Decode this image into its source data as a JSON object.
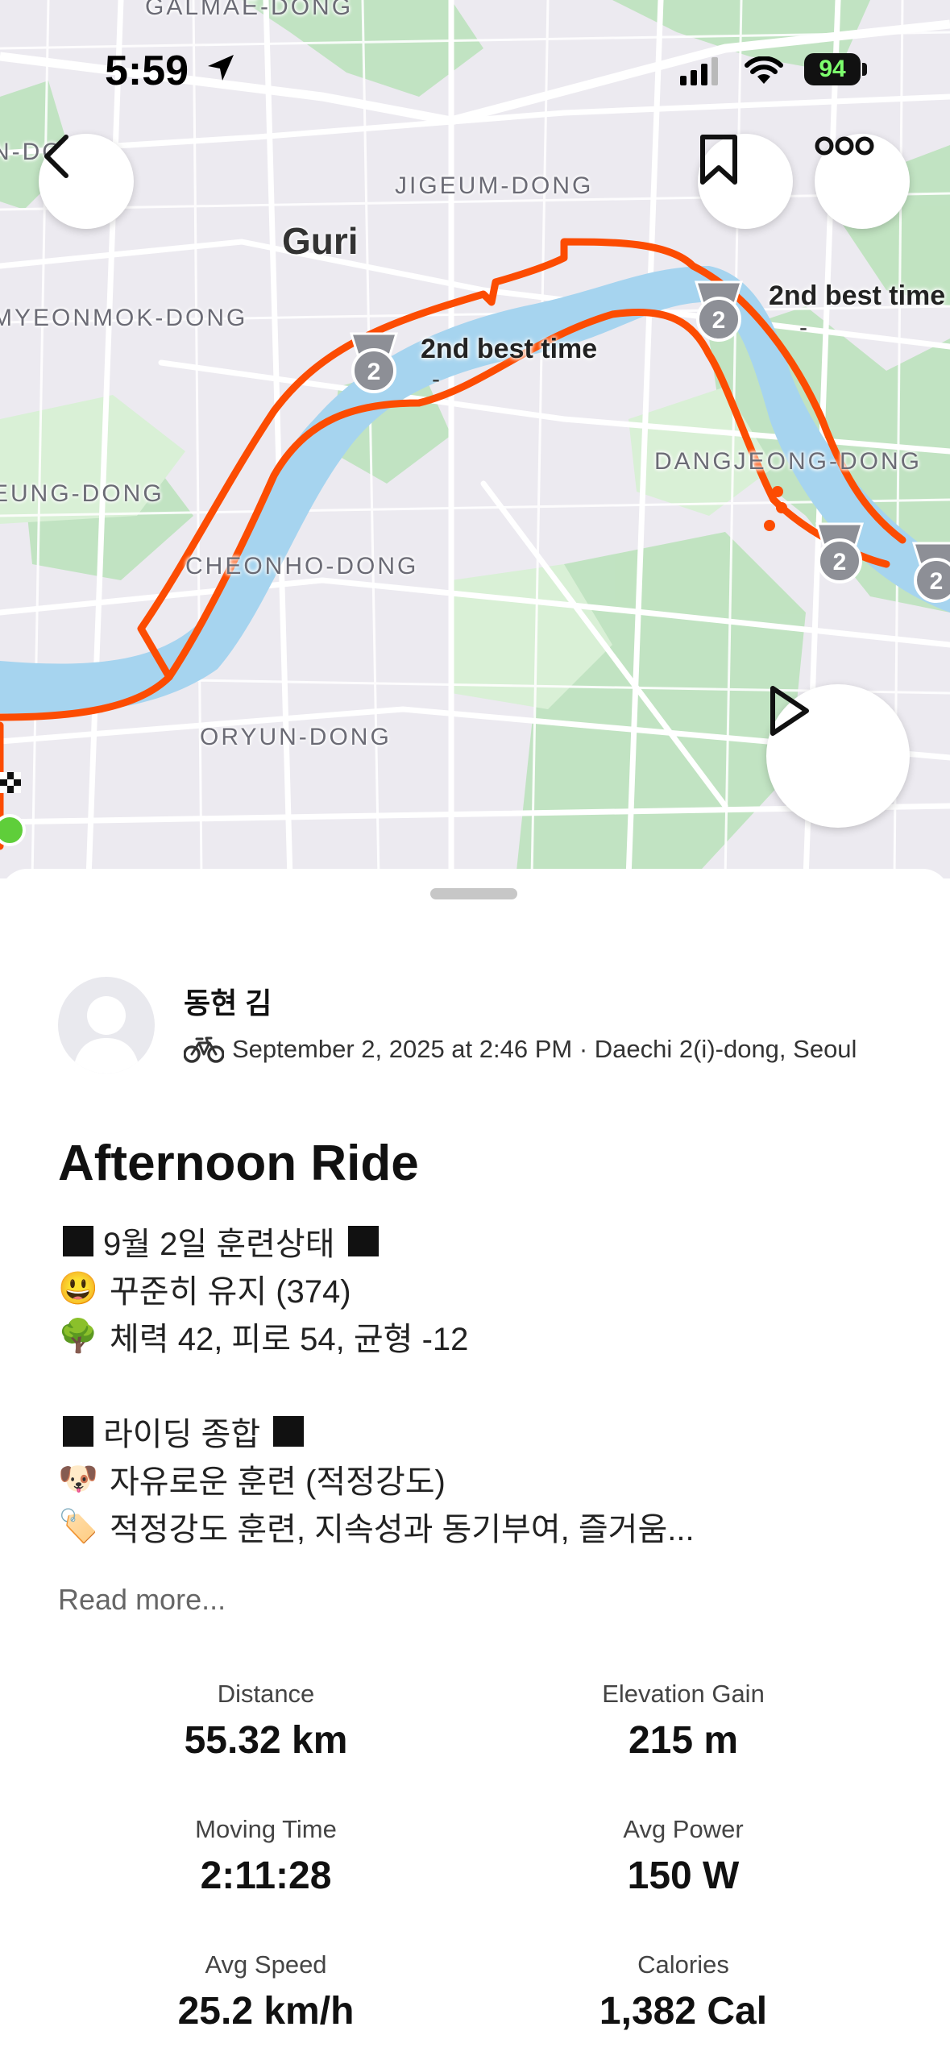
{
  "status_bar": {
    "time": "5:59",
    "battery": "94"
  },
  "map": {
    "labels": {
      "galmae": "GALMAE-DONG",
      "n_dong": "N-DO",
      "jigeum": "JIGEUM-DONG",
      "guri": "Guri",
      "myeonmok": "MYEONMOK-DONG",
      "eung": "EUNG-DONG",
      "dangjeong": "DANGJEONG-DONG",
      "cheonho": "CHEONHO-DONG",
      "oryun": "ORYUN-DONG"
    },
    "segments": [
      {
        "label": "2nd best time",
        "dash": "-",
        "medal": "2"
      },
      {
        "label": "2nd best time",
        "dash": "-",
        "medal": "2"
      }
    ],
    "medal_rank": "2",
    "route_color": "#FC4C02"
  },
  "athlete": {
    "name": "동현 김"
  },
  "activity": {
    "meta": "September 2, 2025 at 2:46 PM · Daechi 2(i)-dong, Seoul",
    "title": "Afternoon Ride",
    "description": {
      "line1": "9월 2일 훈련상태",
      "line2": "꾸준히 유지 (374)",
      "line3": "체력 42, 피로 54, 균형 -12",
      "line4": "라이딩 종합",
      "line5": "자유로운 훈련 (적정강도)",
      "line6": "적정강도 훈련, 지속성과 동기부여, 즐거움..."
    },
    "read_more": "Read more..."
  },
  "stats": [
    {
      "label": "Distance",
      "value": "55.32 km"
    },
    {
      "label": "Elevation Gain",
      "value": "215 m"
    },
    {
      "label": "Moving Time",
      "value": "2:11:28"
    },
    {
      "label": "Avg Power",
      "value": "150 W"
    },
    {
      "label": "Avg Speed",
      "value": "25.2 km/h"
    },
    {
      "label": "Calories",
      "value": "1,382 Cal"
    }
  ]
}
